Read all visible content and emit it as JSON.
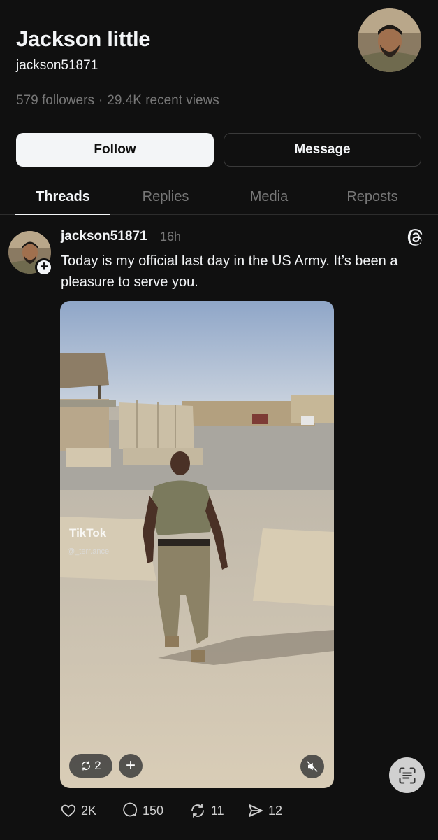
{
  "profile": {
    "name": "Jackson little",
    "handle": "jackson51871",
    "followers": "579 followers",
    "separator": "·",
    "views": "29.4K recent views"
  },
  "buttons": {
    "follow": "Follow",
    "message": "Message"
  },
  "tabs": [
    {
      "label": "Threads",
      "active": true
    },
    {
      "label": "Replies",
      "active": false
    },
    {
      "label": "Media",
      "active": false
    },
    {
      "label": "Reposts",
      "active": false
    }
  ],
  "post": {
    "username": "jackson51871",
    "time": "16h",
    "text": "Today is my official last day in the US Army. It’s been a pleasure to serve you.",
    "media": {
      "watermark": "TikTok",
      "watermark_user": "@_terr.ance",
      "repost_count": "2"
    },
    "actions": {
      "likes": "2K",
      "replies": "150",
      "reposts": "11",
      "shares": "12"
    }
  },
  "colors": {
    "background": "#101010",
    "text_primary": "#f3f5f7",
    "text_secondary": "#777777"
  }
}
